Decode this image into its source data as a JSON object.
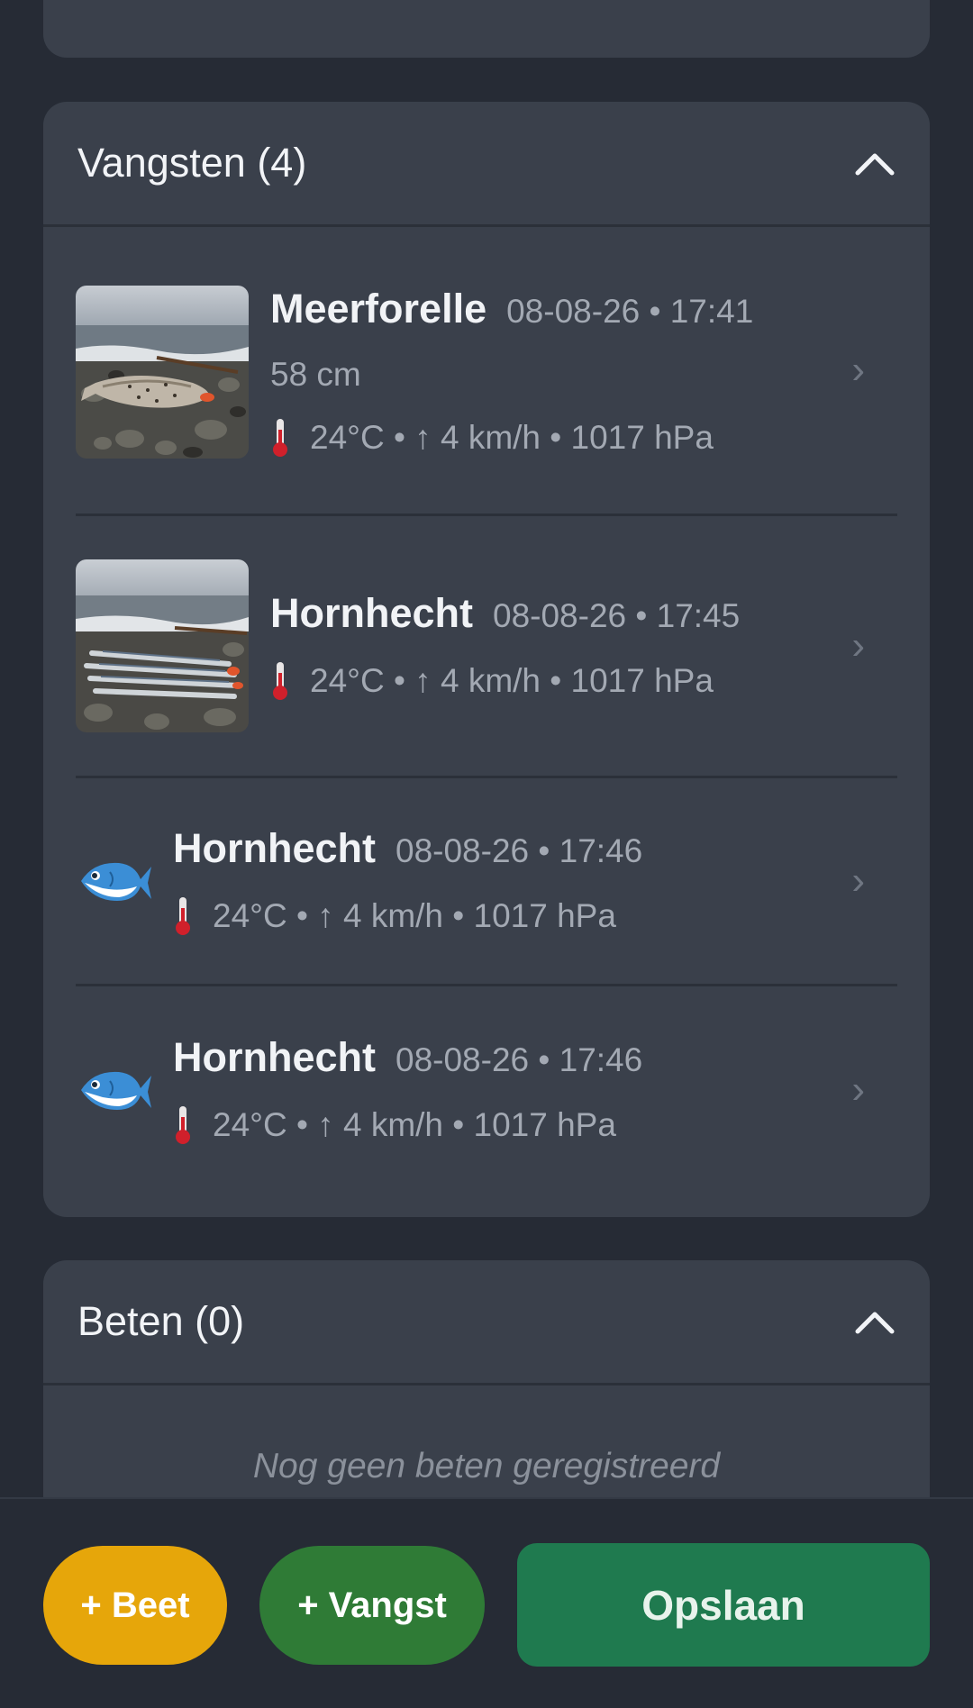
{
  "catches_section": {
    "title": "Vangsten (4)",
    "items": [
      {
        "species": "Meerforelle",
        "datetime": "08-08-26 • 17:41",
        "size": "58 cm",
        "weather": "24°C • ↑ 4 km/h • 1017 hPa",
        "thumbnail": "photo-trout-on-rocks"
      },
      {
        "species": "Hornhecht",
        "datetime": "08-08-26 • 17:45",
        "weather": "24°C • ↑ 4 km/h • 1017 hPa",
        "thumbnail": "photo-garfish-on-rocks"
      },
      {
        "species": "Hornhecht",
        "datetime": "08-08-26 • 17:46",
        "weather": "24°C • ↑ 4 km/h • 1017 hPa",
        "thumbnail": "fish-emoji-icon"
      },
      {
        "species": "Hornhecht",
        "datetime": "08-08-26 • 17:46",
        "weather": "24°C • ↑ 4 km/h • 1017 hPa",
        "thumbnail": "fish-emoji-icon"
      }
    ]
  },
  "bites_section": {
    "title": "Beten (0)",
    "empty_text": "Nog geen beten geregistreerd"
  },
  "actions": {
    "add_bite": "+ Beet",
    "add_catch": "+ Vangst",
    "save": "Opslaan"
  },
  "colors": {
    "background": "#262b35",
    "card": "#3a404b",
    "bite_button": "#e6a60a",
    "catch_button": "#2f7b36",
    "save_button": "#1f7a4f"
  }
}
